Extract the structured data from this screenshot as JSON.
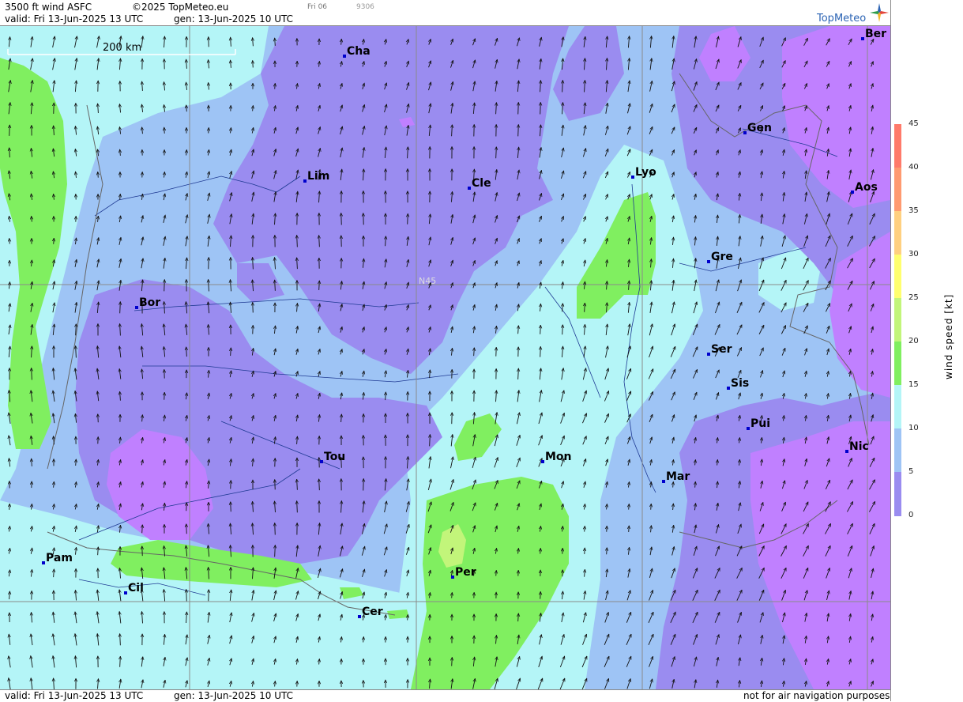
{
  "header": {
    "title": "3500 ft wind ASFC",
    "copyright": "©2025 TopMeteo.eu",
    "valid": "valid:  Fri  13-Jun-2025  13 UTC",
    "gen": "gen: 13-Jun-2025 10 UTC",
    "small_tag": "Fri 06",
    "small_code": "9306",
    "logo": "TopMeteo"
  },
  "footer": {
    "valid": "valid:  Fri  13-Jun-2025  13 UTC",
    "gen": "gen: 13-Jun-2025 10 UTC",
    "disclaimer": "not for air navigation purposes"
  },
  "map": {
    "scale_label": "200 km",
    "lat_label": "N45",
    "cities": [
      "Cha",
      "Ber",
      "Gen",
      "Lim",
      "Cle",
      "Lyo",
      "Aos",
      "Gre",
      "Bor",
      "Ser",
      "Sis",
      "Pui",
      "Nic",
      "Tou",
      "Mon",
      "Mar",
      "Pam",
      "Per",
      "Cil",
      "Cer"
    ]
  },
  "legend": {
    "title": "wind speed [kt]",
    "ticks": [
      "45",
      "40",
      "35",
      "30",
      "25",
      "20",
      "15",
      "10",
      "5",
      "0"
    ],
    "colors": {
      "0": "#c080ff",
      "5": "#9a8cf0",
      "10": "#9ec4f5",
      "15": "#b4f5f7",
      "20": "#80ef60",
      "25": "#c2f57a",
      "30": "#ffff6e",
      "35": "#ffd080",
      "40": "#ff9a70",
      "45": "#ff7a6a"
    }
  },
  "colors": {
    "violet": "#c080ff",
    "purple": "#9a8cf0",
    "blue": "#9ec4f5",
    "cyan": "#b4f5f7",
    "green": "#80ef60"
  }
}
